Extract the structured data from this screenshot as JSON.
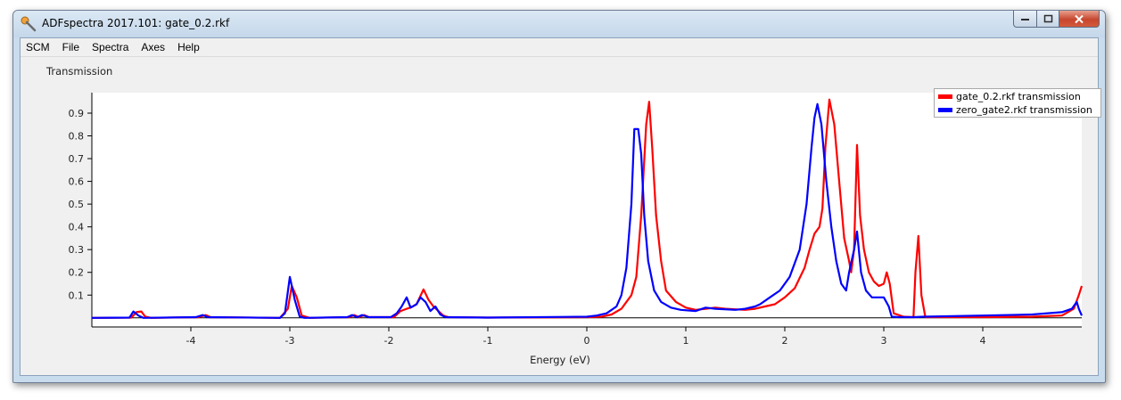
{
  "window": {
    "title": "ADFspectra 2017.101: gate_0.2.rkf",
    "app_icon": "adf-wrench-icon",
    "controls": {
      "minimize": "minimize-icon",
      "maximize": "maximize-icon",
      "close": "close-icon"
    }
  },
  "menu": [
    "SCM",
    "File",
    "Spectra",
    "Axes",
    "Help"
  ],
  "panel": {
    "title": "Transmission"
  },
  "chart_data": {
    "type": "line",
    "title": "",
    "xlabel": "Energy (eV)",
    "ylabel": "",
    "xlim": [
      -5,
      5
    ],
    "ylim": [
      -0.04,
      0.99
    ],
    "x_ticks": [
      -4,
      -3,
      -2,
      -1,
      0,
      1,
      2,
      3,
      4
    ],
    "y_ticks": [
      0.1,
      0.2,
      0.3,
      0.4,
      0.5,
      0.6,
      0.7,
      0.8,
      0.9
    ],
    "grid": false,
    "legend_position": "top-right",
    "baseline": 0,
    "series": [
      {
        "name": "gate_0.2.rkf transmission",
        "color": "#ff0000",
        "points": [
          [
            -5,
            0
          ],
          [
            -4.6,
            0.001
          ],
          [
            -4.55,
            0.025
          ],
          [
            -4.5,
            0.028
          ],
          [
            -4.46,
            0.005
          ],
          [
            -4.4,
            0
          ],
          [
            -3.92,
            0.003
          ],
          [
            -3.85,
            0.012
          ],
          [
            -3.8,
            0.003
          ],
          [
            -3.1,
            0
          ],
          [
            -3.02,
            0.04
          ],
          [
            -2.98,
            0.14
          ],
          [
            -2.93,
            0.09
          ],
          [
            -2.88,
            0.01
          ],
          [
            -2.8,
            0
          ],
          [
            -2.4,
            0.003
          ],
          [
            -2.35,
            0.012
          ],
          [
            -2.3,
            0.003
          ],
          [
            -2.25,
            0.012
          ],
          [
            -2.2,
            0.003
          ],
          [
            -1.95,
            0.003
          ],
          [
            -1.88,
            0.03
          ],
          [
            -1.82,
            0.04
          ],
          [
            -1.78,
            0.045
          ],
          [
            -1.72,
            0.06
          ],
          [
            -1.65,
            0.125
          ],
          [
            -1.6,
            0.08
          ],
          [
            -1.55,
            0.05
          ],
          [
            -1.5,
            0.03
          ],
          [
            -1.45,
            0.01
          ],
          [
            -1.4,
            0.003
          ],
          [
            -1.0,
            0.001
          ],
          [
            0,
            0.003
          ],
          [
            0.15,
            0.005
          ],
          [
            0.25,
            0.015
          ],
          [
            0.35,
            0.04
          ],
          [
            0.45,
            0.1
          ],
          [
            0.5,
            0.18
          ],
          [
            0.55,
            0.45
          ],
          [
            0.6,
            0.85
          ],
          [
            0.63,
            0.95
          ],
          [
            0.66,
            0.75
          ],
          [
            0.7,
            0.45
          ],
          [
            0.75,
            0.25
          ],
          [
            0.8,
            0.12
          ],
          [
            0.9,
            0.07
          ],
          [
            1.0,
            0.045
          ],
          [
            1.1,
            0.035
          ],
          [
            1.2,
            0.04
          ],
          [
            1.3,
            0.045
          ],
          [
            1.4,
            0.04
          ],
          [
            1.6,
            0.035
          ],
          [
            1.7,
            0.04
          ],
          [
            1.8,
            0.05
          ],
          [
            1.9,
            0.06
          ],
          [
            2.0,
            0.09
          ],
          [
            2.1,
            0.13
          ],
          [
            2.2,
            0.22
          ],
          [
            2.25,
            0.3
          ],
          [
            2.3,
            0.37
          ],
          [
            2.35,
            0.4
          ],
          [
            2.38,
            0.48
          ],
          [
            2.41,
            0.75
          ],
          [
            2.45,
            0.96
          ],
          [
            2.5,
            0.85
          ],
          [
            2.55,
            0.6
          ],
          [
            2.6,
            0.35
          ],
          [
            2.65,
            0.25
          ],
          [
            2.67,
            0.2
          ],
          [
            2.7,
            0.3
          ],
          [
            2.73,
            0.76
          ],
          [
            2.76,
            0.45
          ],
          [
            2.8,
            0.3
          ],
          [
            2.85,
            0.2
          ],
          [
            2.9,
            0.16
          ],
          [
            2.95,
            0.14
          ],
          [
            3.0,
            0.15
          ],
          [
            3.03,
            0.2
          ],
          [
            3.06,
            0.15
          ],
          [
            3.1,
            0.02
          ],
          [
            3.2,
            0.005
          ],
          [
            3.3,
            0.003
          ],
          [
            3.32,
            0.2
          ],
          [
            3.35,
            0.36
          ],
          [
            3.38,
            0.1
          ],
          [
            3.42,
            0.003
          ],
          [
            4.0,
            0.003
          ],
          [
            4.5,
            0.005
          ],
          [
            4.8,
            0.01
          ],
          [
            4.92,
            0.04
          ],
          [
            4.97,
            0.1
          ],
          [
            5.0,
            0.14
          ]
        ]
      },
      {
        "name": "zero_gate2.rkf transmission",
        "color": "#0000ff",
        "points": [
          [
            -5,
            0
          ],
          [
            -4.62,
            0.001
          ],
          [
            -4.58,
            0.028
          ],
          [
            -4.53,
            0.01
          ],
          [
            -4.48,
            0
          ],
          [
            -3.95,
            0.003
          ],
          [
            -3.88,
            0.012
          ],
          [
            -3.83,
            0.003
          ],
          [
            -3.1,
            0
          ],
          [
            -3.05,
            0.02
          ],
          [
            -3.0,
            0.18
          ],
          [
            -2.95,
            0.08
          ],
          [
            -2.9,
            0.005
          ],
          [
            -2.85,
            0
          ],
          [
            -2.42,
            0.003
          ],
          [
            -2.37,
            0.012
          ],
          [
            -2.32,
            0.003
          ],
          [
            -2.27,
            0.012
          ],
          [
            -2.2,
            0.003
          ],
          [
            -1.98,
            0.003
          ],
          [
            -1.92,
            0.02
          ],
          [
            -1.87,
            0.05
          ],
          [
            -1.82,
            0.09
          ],
          [
            -1.78,
            0.045
          ],
          [
            -1.72,
            0.06
          ],
          [
            -1.68,
            0.09
          ],
          [
            -1.63,
            0.07
          ],
          [
            -1.58,
            0.03
          ],
          [
            -1.53,
            0.05
          ],
          [
            -1.48,
            0.015
          ],
          [
            -1.43,
            0.003
          ],
          [
            -1.0,
            0.001
          ],
          [
            0,
            0.005
          ],
          [
            0.1,
            0.01
          ],
          [
            0.2,
            0.02
          ],
          [
            0.3,
            0.05
          ],
          [
            0.35,
            0.1
          ],
          [
            0.4,
            0.22
          ],
          [
            0.45,
            0.5
          ],
          [
            0.48,
            0.83
          ],
          [
            0.52,
            0.83
          ],
          [
            0.55,
            0.72
          ],
          [
            0.58,
            0.45
          ],
          [
            0.62,
            0.25
          ],
          [
            0.68,
            0.12
          ],
          [
            0.75,
            0.07
          ],
          [
            0.85,
            0.045
          ],
          [
            0.95,
            0.035
          ],
          [
            1.1,
            0.03
          ],
          [
            1.2,
            0.045
          ],
          [
            1.3,
            0.04
          ],
          [
            1.5,
            0.035
          ],
          [
            1.6,
            0.04
          ],
          [
            1.7,
            0.05
          ],
          [
            1.75,
            0.06
          ],
          [
            1.85,
            0.09
          ],
          [
            1.95,
            0.12
          ],
          [
            2.05,
            0.18
          ],
          [
            2.15,
            0.3
          ],
          [
            2.22,
            0.5
          ],
          [
            2.27,
            0.75
          ],
          [
            2.3,
            0.88
          ],
          [
            2.33,
            0.94
          ],
          [
            2.37,
            0.85
          ],
          [
            2.42,
            0.6
          ],
          [
            2.47,
            0.4
          ],
          [
            2.52,
            0.25
          ],
          [
            2.57,
            0.15
          ],
          [
            2.62,
            0.12
          ],
          [
            2.65,
            0.2
          ],
          [
            2.7,
            0.3
          ],
          [
            2.73,
            0.38
          ],
          [
            2.77,
            0.2
          ],
          [
            2.82,
            0.12
          ],
          [
            2.88,
            0.09
          ],
          [
            2.95,
            0.09
          ],
          [
            3.0,
            0.09
          ],
          [
            3.05,
            0.05
          ],
          [
            3.08,
            0.005
          ],
          [
            3.15,
            0.003
          ],
          [
            3.3,
            0.003
          ],
          [
            3.4,
            0.005
          ],
          [
            4.0,
            0.01
          ],
          [
            4.5,
            0.015
          ],
          [
            4.8,
            0.025
          ],
          [
            4.9,
            0.04
          ],
          [
            4.95,
            0.07
          ],
          [
            4.97,
            0.04
          ],
          [
            5.0,
            0.01
          ]
        ]
      }
    ]
  }
}
